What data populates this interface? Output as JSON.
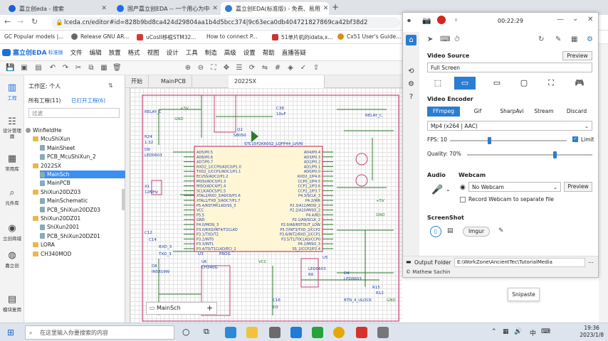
{
  "browser": {
    "tabs": [
      {
        "label": "嘉立创eda - 搜索",
        "color": "#1d5fd1"
      },
      {
        "label": "国产嘉立创EDA -- 一个用心为中",
        "color": "#1f6ee8"
      },
      {
        "label": "嘉立创EDA(标准版) - 免费、易用",
        "color": "#2b7cd3"
      }
    ],
    "new_tab": "+",
    "window_controls": {
      "min": "—",
      "max": "☐",
      "close": "✕"
    },
    "url": "lceda.cn/editor#id=828b9bd8ca424d29804aa1b4d5bcc374|9c63eca0db404721827869ca42bf38d2",
    "bookmarks": [
      {
        "label": "GC Popular models |...",
        "color": "#333"
      },
      {
        "label": "Release GNU AR...",
        "color": "#666"
      },
      {
        "label": "uCosII移植STM32...",
        "color": "#d43a2f"
      },
      {
        "label": "How to connect P...",
        "color": "#4a6fa5"
      },
      {
        "label": "51单片机的idata,x...",
        "color": "#c33"
      },
      {
        "label": "Cx51 User's Guide...",
        "color": "#e08a1e"
      }
    ]
  },
  "app": {
    "logo": "嘉立创EDA",
    "edition": "标准版",
    "menus": [
      "文件",
      "编辑",
      "放置",
      "格式",
      "视图",
      "设计",
      "工具",
      "制造",
      "高级",
      "设置",
      "帮助",
      "直播答疑"
    ]
  },
  "rail": [
    "工程",
    "设计管理器",
    "常用库",
    "元件库",
    "立创商城",
    "嘉立创",
    "模块复用"
  ],
  "project": {
    "workspace": "工作区: 个人",
    "tab_all": "所有工程(11)",
    "tab_open": "已打开工程(6)",
    "filter_placeholder": "过滤",
    "tree": [
      {
        "label": "WinfieldHe",
        "indent": 0,
        "kind": "user"
      },
      {
        "label": "McuShiXun",
        "indent": 1,
        "kind": "folder"
      },
      {
        "label": "MainSheet",
        "indent": 2,
        "kind": "doc"
      },
      {
        "label": "PCB_McuShiXun_2",
        "indent": 2,
        "kind": "doc"
      },
      {
        "label": "2022SX",
        "indent": 1,
        "kind": "folder"
      },
      {
        "label": "MainSch",
        "indent": 2,
        "kind": "doc",
        "selected": true
      },
      {
        "label": "MainPCB",
        "indent": 2,
        "kind": "doc"
      },
      {
        "label": "ShiXun20DZ03",
        "indent": 1,
        "kind": "folder"
      },
      {
        "label": "MainSchematic",
        "indent": 2,
        "kind": "doc"
      },
      {
        "label": "PCB_ShiXun20DZ03",
        "indent": 2,
        "kind": "doc"
      },
      {
        "label": "ShiXun20DZ01",
        "indent": 1,
        "kind": "folder"
      },
      {
        "label": "ShiXun2001",
        "indent": 2,
        "kind": "doc"
      },
      {
        "label": "PCB_ShiXun20DZ01",
        "indent": 2,
        "kind": "doc"
      },
      {
        "label": "LORA",
        "indent": 1,
        "kind": "folder"
      },
      {
        "label": "CH340MOD",
        "indent": 1,
        "kind": "folder"
      }
    ]
  },
  "doc_tabs": [
    "开始",
    "MainPCB",
    "2022SX"
  ],
  "sheet_tab": "MainSch",
  "schematic": {
    "chip_label": "STC15F2K60S2_LQFP44_LVVN",
    "left_pins": [
      "AD5/P0.5",
      "AD6/P0.6",
      "AD7/P0.7",
      "RXD2_1/CCP0/ADC0/P1.0",
      "TXD2_1/CCP1/ADC1/P1.1",
      "ECI/SS/ADC2/P1.2",
      "MOSI/ADC3/P1.3",
      "MISO/ADC4/P1.4",
      "SCLK/ADC5/P1.5",
      "XTAL2/RXD_3/ADC6/P1.6",
      "XTAL1/TXD_3/ADC7/P1.7",
      "P5.4/RST/MCLKO/SS_3",
      "VCC",
      "P5.5",
      "GND",
      "P4.0/MOSI_3",
      "P3.0/RXD/INT4/T2CLKO",
      "P3.1/TXD/T2",
      "P3.2/INT0",
      "P3.3/INT1",
      "P3.4/T0/T1CLKO/ECI_2"
    ],
    "right_pins": [
      "AD4/P0.4",
      "AD3/P0.3",
      "AD2/P0.2",
      "AD1/P0.1",
      "AD0/P0.0",
      "RXD2_2/P4.6",
      "CCP0_2/P4.5",
      "CCP1_2/P3.6",
      "CCP2_2/P3.7",
      "P4.3/SCLK_3",
      "P4.2/WR",
      "P2.3/A11/MOSI_2",
      "P2.2/A10/MISO_2",
      "P4.4/RD",
      "P2.1/A9/SCLK_2",
      "P2.0/A8/RSTOUT_LOW",
      "P3.7/INT3/TXD_2/CCP2",
      "P3.6/INT2/RXD_2/CCP1",
      "P3.5/T1/T0CLKO/CCP0",
      "P4.1/MISO_3",
      "SS_2/CCP2/P2.4"
    ],
    "labels": [
      {
        "t": "RELAY_C"
      },
      {
        "t": "R24"
      },
      {
        "t": "1.32"
      },
      {
        "t": "D9"
      },
      {
        "t": "LED0603"
      },
      {
        "t": "+5V"
      },
      {
        "t": "GND"
      },
      {
        "t": "C38"
      },
      {
        "t": "10uF"
      },
      {
        "t": "Q2"
      },
      {
        "t": "S8050"
      },
      {
        "t": "X1"
      },
      {
        "t": "12MHz"
      },
      {
        "t": "C12"
      },
      {
        "t": "C14"
      },
      {
        "t": "D8"
      },
      {
        "t": "IN5819W"
      },
      {
        "t": "U6"
      },
      {
        "t": "CH340G"
      },
      {
        "t": "VCC"
      },
      {
        "t": "C16"
      },
      {
        "t": "D3"
      },
      {
        "t": "LED0603"
      },
      {
        "t": "R6"
      },
      {
        "t": "U5"
      },
      {
        "t": "D4"
      },
      {
        "t": "LED0603"
      },
      {
        "t": "R15"
      },
      {
        "t": "R12"
      },
      {
        "t": "BTN_4_ULOCK"
      },
      {
        "t": "+5V"
      },
      {
        "t": "GND"
      },
      {
        "t": "RXD_3"
      },
      {
        "t": "TXD_3"
      },
      {
        "t": "U3"
      },
      {
        "t": "PROG"
      },
      {
        "t": "RELAY_C"
      },
      {
        "t": "GND"
      }
    ]
  },
  "recorder": {
    "timer": "00:22:29",
    "video_source": {
      "title": "Video Source",
      "preview": "Preview",
      "value": "Full Screen",
      "icons": [
        "cursor-icon",
        "monitor-icon",
        "screen-icon",
        "window-icon",
        "region-icon",
        "gamepad-icon"
      ]
    },
    "video_encoder": {
      "title": "Video Encoder",
      "options": [
        "FFmpeg",
        "Gif",
        "SharpAvi",
        "Stream",
        "Discard"
      ],
      "selected": "FFmpeg",
      "codec": "Mp4 (x264 | AAC)"
    },
    "fps": {
      "label": "FPS:",
      "value": "10",
      "limit_label": "Limit",
      "limit_checked": true
    },
    "quality": {
      "label": "Quality:",
      "value": "70%"
    },
    "audio": {
      "title": "Audio"
    },
    "webcam": {
      "title": "Webcam",
      "value": "No Webcam",
      "preview": "Preview",
      "separate_label": "Record Webcam to separate file"
    },
    "screenshot": {
      "title": "ScreenShot",
      "service": "Imgur"
    },
    "output": {
      "label": "Output Folder",
      "path": "E:\\WorkZone\\AncientTec\\TutorialMedia"
    },
    "author": "© Mathew Sachin"
  },
  "snipaste": "Snipaste",
  "taskbar": {
    "search_placeholder": "在这里输入你要搜索的内容",
    "time": "19:36",
    "date": "2023/1/8",
    "ime": "中"
  }
}
